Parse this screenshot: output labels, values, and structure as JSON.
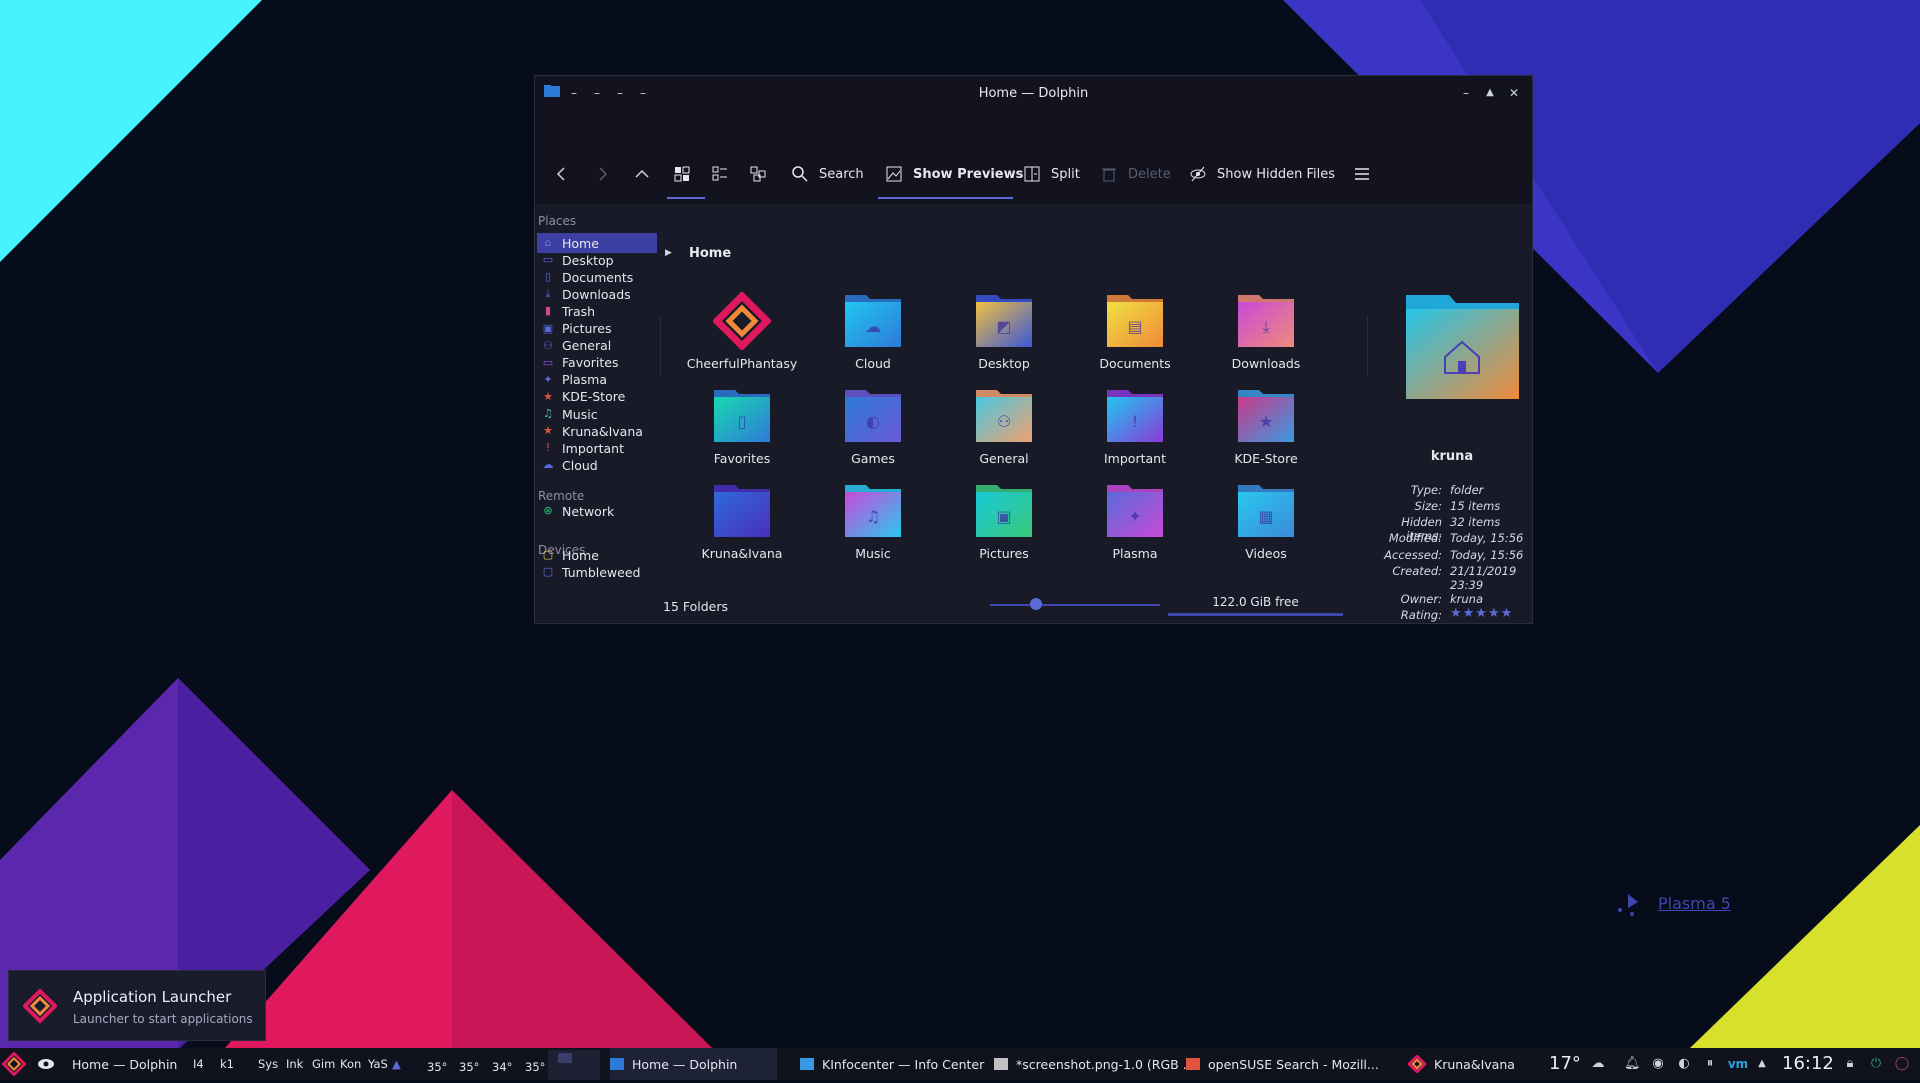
{
  "window": {
    "title": "Home — Dolphin",
    "toolbar": {
      "search": "Search",
      "show_previews": "Show Previews",
      "split": "Split",
      "delete": "Delete",
      "show_hidden": "Show Hidden Files"
    },
    "sidebar": {
      "places_header": "Places",
      "places": [
        "Home",
        "Desktop",
        "Documents",
        "Downloads",
        "Trash",
        "Pictures",
        "General",
        "Favorites",
        "Plasma",
        "KDE-Store",
        "Music",
        "Kruna&Ivana",
        "Important",
        "Cloud"
      ],
      "remote_header": "Remote",
      "remote": [
        "Network"
      ],
      "devices_header": "Devices",
      "devices": [
        "Home",
        "Tumbleweed"
      ]
    },
    "breadcrumb": "Home",
    "folders": [
      "CheerfulPhantasy",
      "Cloud",
      "Desktop",
      "Documents",
      "Downloads",
      "Favorites",
      "Games",
      "General",
      "Important",
      "KDE-Store",
      "Kruna&Ivana",
      "Music",
      "Pictures",
      "Plasma",
      "Videos"
    ],
    "status": "15 Folders",
    "free_space": "122.0 GiB free",
    "zoom_fraction": 0.27,
    "info": {
      "name": "kruna",
      "rows": [
        {
          "k": "Type:",
          "v": "folder"
        },
        {
          "k": "Size:",
          "v": "15 items"
        },
        {
          "k": "Hidden items:",
          "v": "32 items"
        },
        {
          "k": "Modified:",
          "v": "Today, 15:56"
        },
        {
          "k": "Accessed:",
          "v": "Today, 15:56"
        },
        {
          "k": "Created:",
          "v": "21/11/2019 23:39"
        },
        {
          "k": "Owner:",
          "v": "kruna"
        },
        {
          "k": "Rating:",
          "v": ""
        }
      ],
      "rating_stars": 5
    }
  },
  "tooltip": {
    "title": "Application Launcher",
    "subtitle": "Launcher to start applications"
  },
  "watermark": "Plasma 5",
  "taskbar": {
    "active_window": "Home — Dolphin",
    "pager": [
      "I4",
      "k1"
    ],
    "launchers": [
      "Sys",
      "Ink",
      "Gim",
      "Kon",
      "YaS"
    ],
    "temps": [
      "35°",
      "35°",
      "34°",
      "35°"
    ],
    "tasks": [
      "Home — Dolphin",
      "KInfocenter — Info Center",
      "*screenshot.png-1.0 (RGB ...",
      "openSUSE Search - Mozill..."
    ],
    "user": "Kruna&Ivana",
    "weather_temp": "17°",
    "clock": "16:12"
  },
  "colors": {
    "accent": "#3c3fa4",
    "cyan": "#47f3ff",
    "blue": "#3a35c4",
    "purple": "#6a2fbe",
    "pink": "#e0195f",
    "yellow": "#d7e02a"
  }
}
